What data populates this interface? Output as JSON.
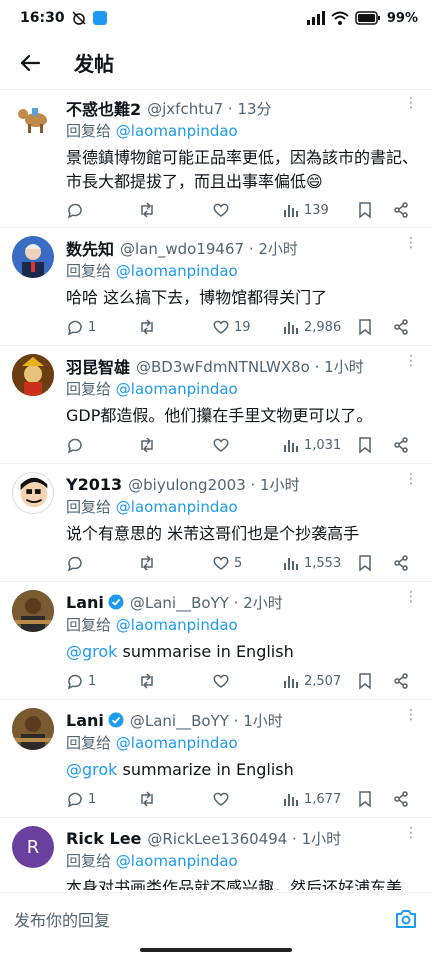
{
  "status_bar": {
    "time": "16:30",
    "battery": "99%"
  },
  "header": {
    "title": "发帖"
  },
  "tweets": [
    {
      "name": "不惑也難2",
      "handle": "@jxfchtu7 · 13分",
      "reply_prefix": "回复给",
      "reply_to": "@laomanpindao",
      "text": "景德鎮博物館可能正品率更低，因為該市的書記、市長大都提拔了，而且出事率偏低😄",
      "stats": {
        "replies": "",
        "retweets": "",
        "likes": "",
        "views": "139"
      }
    },
    {
      "name": "数先知",
      "handle": "@lan_wdo19467 · 2小时",
      "reply_prefix": "回复给",
      "reply_to": "@laomanpindao",
      "text": "哈哈 这么搞下去，博物馆都得关门了",
      "stats": {
        "replies": "1",
        "retweets": "",
        "likes": "19",
        "views": "2,986"
      }
    },
    {
      "name": "羽昆智雄",
      "handle": "@BD3wFdmNTNLWX8o · 1小时",
      "reply_prefix": "回复给",
      "reply_to": "@laomanpindao",
      "text": "GDP都造假。他们攥在手里文物更可以了。",
      "stats": {
        "replies": "",
        "retweets": "",
        "likes": "",
        "views": "1,031"
      }
    },
    {
      "name": "Y2013",
      "handle": "@biyulong2003 · 1小时",
      "reply_prefix": "回复给",
      "reply_to": "@laomanpindao",
      "text": "说个有意思的 米芾这哥们也是个抄袭高手",
      "stats": {
        "replies": "",
        "retweets": "",
        "likes": "5",
        "views": "1,553"
      }
    },
    {
      "name": "Lani",
      "handle": "@Lani__BoYY · 2小时",
      "reply_prefix": "回复给",
      "reply_to": "@laomanpindao",
      "mention": "@grok",
      "text": " summarise in English",
      "stats": {
        "replies": "1",
        "retweets": "",
        "likes": "",
        "views": "2,507"
      }
    },
    {
      "name": "Lani",
      "handle": "@Lani__BoYY · 1小时",
      "reply_prefix": "回复给",
      "reply_to": "@laomanpindao",
      "mention": "@grok",
      "text": " summarize in English",
      "stats": {
        "replies": "1",
        "retweets": "",
        "likes": "",
        "views": "1,677"
      }
    },
    {
      "name": "Rick Lee",
      "handle": "@RickLee1360494 · 1小时",
      "reply_prefix": "回复给",
      "reply_to": "@laomanpindao",
      "text": "本身对书画类作品就不感兴趣，然后还好浦东美",
      "avatar_letter": "R",
      "stats": {
        "replies": "",
        "retweets": "",
        "likes": "",
        "views": ""
      }
    }
  ],
  "reply_bar": {
    "placeholder": "发布你的回复"
  },
  "colors": {
    "accent": "#1d9bf0",
    "muted": "#536471",
    "text": "#0f1419"
  }
}
